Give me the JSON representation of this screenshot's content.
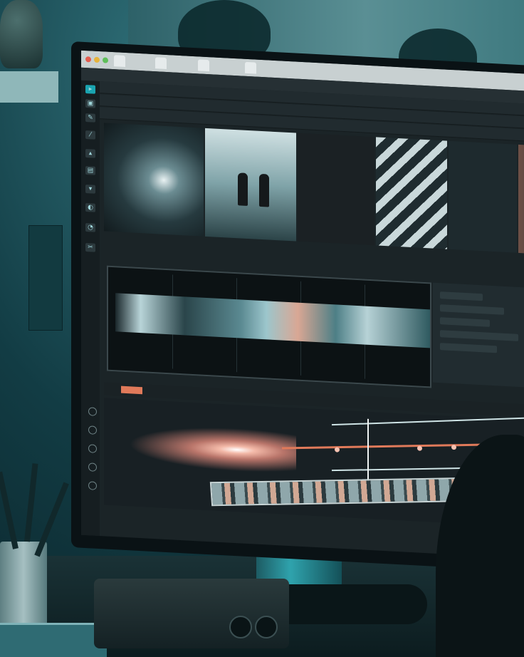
{
  "app": {
    "tabs": [
      "",
      "",
      "",
      ""
    ]
  },
  "timeline": {
    "playhead_label": ""
  },
  "colors": {
    "accent": "#1aa4b0",
    "playhead_marker": "#e07a5a",
    "curve_orange": "#e07a5a",
    "curve_white": "#cfe4e6"
  },
  "icons": {
    "toolbar": [
      "select-icon",
      "crop-icon",
      "pen-icon",
      "brush-icon",
      "mask-icon",
      "text-icon",
      "fx-icon",
      "color-icon",
      "audio-icon",
      "cut-icon"
    ]
  }
}
